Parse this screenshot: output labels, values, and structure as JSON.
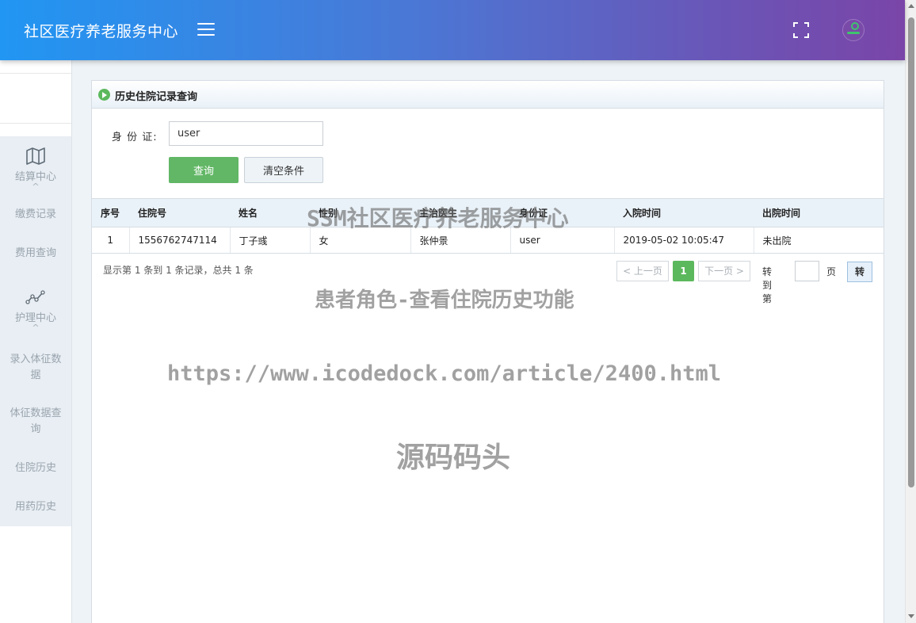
{
  "header": {
    "brand": "社区医疗养老服务中心",
    "menu_icon": "hamburger-icon",
    "fullscreen_icon": "fullscreen-icon",
    "avatar_icon": "user-avatar",
    "gradient": [
      "#2196f3",
      "#7a45a8"
    ]
  },
  "sidebar": {
    "groups": [
      {
        "label": "结算中心",
        "icon": "map-icon",
        "caret": "^"
      },
      {
        "label": "护理中心",
        "icon": "line-chart-icon",
        "caret": "^"
      }
    ],
    "items": [
      {
        "label": "缴费记录"
      },
      {
        "label": "费用查询"
      },
      {
        "label": "录入体征数据"
      },
      {
        "label": "体征数据查询"
      },
      {
        "label": "住院历史"
      },
      {
        "label": "用药历史"
      }
    ]
  },
  "panel": {
    "title": "历史住院记录查询",
    "title_icon": "play-circle-icon"
  },
  "form": {
    "id_label": "身 份 证:",
    "id_value": "user",
    "query_label": "查询",
    "clear_label": "清空条件"
  },
  "table": {
    "headers": [
      "序号",
      "住院号",
      "姓名",
      "性别",
      "主治医生",
      "身份证",
      "入院时间",
      "出院时间"
    ],
    "rows": [
      [
        "1",
        "1556762747114",
        "丁子彧",
        "女",
        "张仲景",
        "user",
        "2019-05-02 10:05:47",
        "未出院"
      ]
    ]
  },
  "pager": {
    "summary": "显示第 1 条到 1 条记录，总共 1 条",
    "prev": "< 上一页",
    "current": "1",
    "next": "下一页 >",
    "goto_label": "转到第",
    "page_unit": "页",
    "go": "转"
  },
  "watermarks": {
    "line1": "SSM社区医疗养老服务中心",
    "line2": "患者角色-查看住院历史功能",
    "line3": "https://www.icodedock.com/article/2400.html",
    "line4": "源码码头"
  },
  "colors": {
    "accent_green": "#5cb85c",
    "table_header_bg": "#eaf2f9",
    "sidebar_nav_bg": "#e8eef3"
  }
}
